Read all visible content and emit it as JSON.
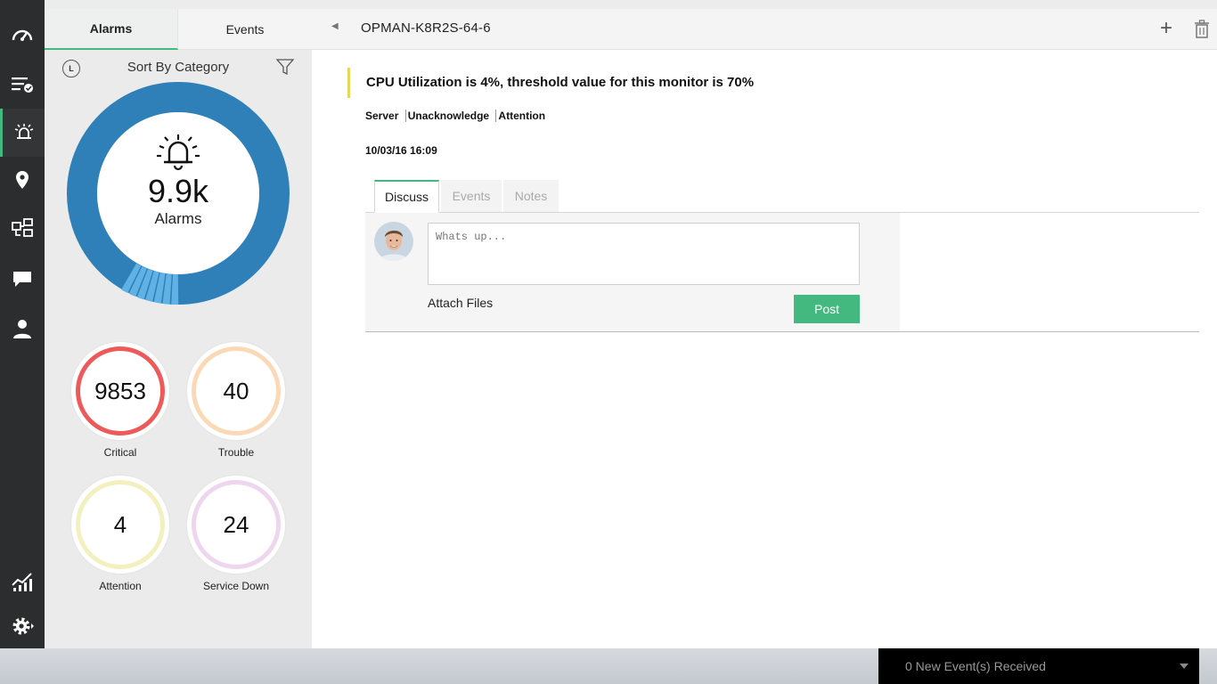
{
  "top_tabs": {
    "alarms": "Alarms",
    "events": "Events"
  },
  "device": {
    "name": "OPMAN-K8R2S-64-6"
  },
  "left_panel": {
    "clock_letter": "L",
    "sort_label": "Sort By Category",
    "donut": {
      "value": "9.9k",
      "label": "Alarms"
    },
    "stats": [
      {
        "value": "9853",
        "label": "Critical",
        "color": "#ee5a5a"
      },
      {
        "value": "40",
        "label": "Trouble",
        "color": "#fcd9b6"
      },
      {
        "value": "4",
        "label": "Attention",
        "color": "#f3f0c0"
      },
      {
        "value": "24",
        "label": "Service Down",
        "color": "#eed6ef"
      }
    ]
  },
  "alarm": {
    "message": "CPU Utilization is 4%, threshold value for this monitor is 70%",
    "tags": [
      "Server",
      "Unacknowledge",
      "Attention"
    ],
    "timestamp": "10/03/16 16:09"
  },
  "detail_tabs": {
    "discuss": "Discuss",
    "events": "Events",
    "notes": "Notes"
  },
  "discuss": {
    "placeholder": "Whats up...",
    "attach_label": "Attach Files",
    "post_label": "Post"
  },
  "event_bar": {
    "text": "0 New Event(s) Received"
  },
  "colors": {
    "accent": "#43b97f",
    "donut": "#2f80b9",
    "rail": "#2b2d2f"
  }
}
